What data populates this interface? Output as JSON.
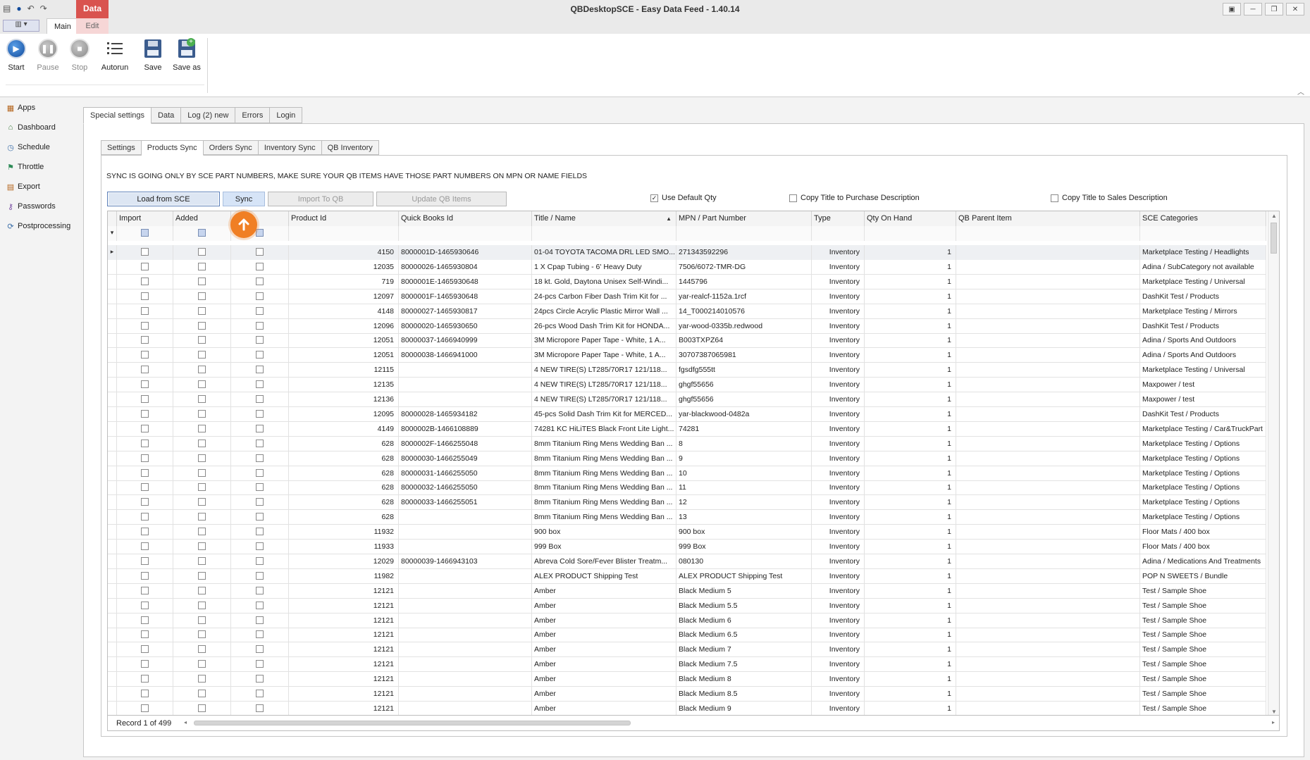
{
  "window": {
    "title": "QBDesktopSCE - Easy Data Feed - 1.40.14",
    "context_tab": "Data",
    "controls": [
      "restore",
      "minimize",
      "maximize",
      "close"
    ]
  },
  "ribbon_tabs": {
    "main": "Main",
    "edit": "Edit"
  },
  "ribbon": {
    "start": "Start",
    "pause": "Pause",
    "stop": "Stop",
    "autorun": "Autorun",
    "save": "Save",
    "save_as": "Save as"
  },
  "nav": [
    {
      "label": "Apps",
      "icon": "apps-icon"
    },
    {
      "label": "Dashboard",
      "icon": "dashboard-icon"
    },
    {
      "label": "Schedule",
      "icon": "schedule-icon"
    },
    {
      "label": "Throttle",
      "icon": "flag-icon"
    },
    {
      "label": "Export",
      "icon": "export-icon"
    },
    {
      "label": "Passwords",
      "icon": "passwords-icon"
    },
    {
      "label": "Postprocessing",
      "icon": "postprocessing-icon"
    }
  ],
  "outer_tabs": [
    "Special settings",
    "Data",
    "Log (2) new",
    "Errors",
    "Login"
  ],
  "inner_tabs": [
    "Settings",
    "Products Sync",
    "Orders Sync",
    "Inventory Sync",
    "QB Inventory"
  ],
  "notice": "SYNC IS GOING ONLY BY SCE PART NUMBERS, MAKE SURE YOUR QB ITEMS HAVE THOSE PART NUMBERS ON MPN OR NAME FIELDS",
  "buttons": {
    "load": "Load from SCE",
    "sync": "Sync",
    "import": "Import To QB",
    "update": "Update QB Items"
  },
  "options": {
    "use_default_qty": {
      "label": "Use Default Qty",
      "checked": true
    },
    "copy_purchase": {
      "label": "Copy Title to Purchase Description",
      "checked": false
    },
    "copy_sales": {
      "label": "Copy Title to Sales Description",
      "checked": false
    }
  },
  "columns": [
    "Import",
    "Added",
    "",
    "Product Id",
    "Quick Books Id",
    "Title / Name",
    "MPN / Part Number",
    "Type",
    "Qty On Hand",
    "QB Parent Item",
    "SCE Categories"
  ],
  "rows": [
    {
      "id": "4150",
      "qb": "8000001D-1465930646",
      "title": "01-04 TOYOTA TACOMA DRL LED SMO...",
      "mpn": "271343592296",
      "type": "Inventory",
      "qty": "1",
      "parent": "",
      "cat": "Marketplace Testing / Headlights"
    },
    {
      "id": "12035",
      "qb": "80000026-1465930804",
      "title": "1 X Cpap Tubing - 6' Heavy Duty",
      "mpn": "7506/6072-TMR-DG",
      "type": "Inventory",
      "qty": "1",
      "parent": "",
      "cat": "Adina / SubCategory not available"
    },
    {
      "id": "719",
      "qb": "8000001E-1465930648",
      "title": "18 kt. Gold, Daytona Unisex Self-Windi...",
      "mpn": "1445796",
      "type": "Inventory",
      "qty": "1",
      "parent": "",
      "cat": "Marketplace Testing / Universal"
    },
    {
      "id": "12097",
      "qb": "8000001F-1465930648",
      "title": "24-pcs Carbon Fiber Dash Trim Kit for ...",
      "mpn": "yar-realcf-1152a.1rcf",
      "type": "Inventory",
      "qty": "1",
      "parent": "",
      "cat": "DashKit Test / Products"
    },
    {
      "id": "4148",
      "qb": "80000027-1465930817",
      "title": "24pcs Circle Acrylic Plastic Mirror Wall ...",
      "mpn": "14_T000214010576",
      "type": "Inventory",
      "qty": "1",
      "parent": "",
      "cat": "Marketplace Testing / Mirrors"
    },
    {
      "id": "12096",
      "qb": "80000020-1465930650",
      "title": "26-pcs Wood Dash Trim Kit for HONDA...",
      "mpn": "yar-wood-0335b.redwood",
      "type": "Inventory",
      "qty": "1",
      "parent": "",
      "cat": "DashKit Test / Products"
    },
    {
      "id": "12051",
      "qb": "80000037-1466940999",
      "title": "3M Micropore Paper Tape - White, 1 A...",
      "mpn": "B003TXPZ64",
      "type": "Inventory",
      "qty": "1",
      "parent": "",
      "cat": "Adina / Sports And Outdoors"
    },
    {
      "id": "12051",
      "qb": "80000038-1466941000",
      "title": "3M Micropore Paper Tape - White, 1 A...",
      "mpn": "30707387065981",
      "type": "Inventory",
      "qty": "1",
      "parent": "",
      "cat": "Adina / Sports And Outdoors"
    },
    {
      "id": "12115",
      "qb": "",
      "title": "4 NEW TIRE(S) LT285/70R17 121/118...",
      "mpn": "fgsdfg555tt",
      "type": "Inventory",
      "qty": "1",
      "parent": "",
      "cat": "Marketplace Testing / Universal"
    },
    {
      "id": "12135",
      "qb": "",
      "title": "4 NEW TIRE(S) LT285/70R17 121/118...",
      "mpn": "ghgf55656",
      "type": "Inventory",
      "qty": "1",
      "parent": "",
      "cat": "Maxpower / test"
    },
    {
      "id": "12136",
      "qb": "",
      "title": "4 NEW TIRE(S) LT285/70R17 121/118...",
      "mpn": "ghgf55656",
      "type": "Inventory",
      "qty": "1",
      "parent": "",
      "cat": "Maxpower / test"
    },
    {
      "id": "12095",
      "qb": "80000028-1465934182",
      "title": "45-pcs Solid Dash Trim Kit for MERCED...",
      "mpn": "yar-blackwood-0482a",
      "type": "Inventory",
      "qty": "1",
      "parent": "",
      "cat": "DashKit Test / Products"
    },
    {
      "id": "4149",
      "qb": "8000002B-1466108889",
      "title": "74281 KC HiLiTES Black Front Lite Light...",
      "mpn": "74281",
      "type": "Inventory",
      "qty": "1",
      "parent": "",
      "cat": "Marketplace Testing / Car&TruckPart"
    },
    {
      "id": "628",
      "qb": "8000002F-1466255048",
      "title": "8mm Titanium Ring Mens Wedding Ban ...",
      "mpn": "8",
      "type": "Inventory",
      "qty": "1",
      "parent": "",
      "cat": "Marketplace Testing / Options"
    },
    {
      "id": "628",
      "qb": "80000030-1466255049",
      "title": "8mm Titanium Ring Mens Wedding Ban ...",
      "mpn": "9",
      "type": "Inventory",
      "qty": "1",
      "parent": "",
      "cat": "Marketplace Testing / Options"
    },
    {
      "id": "628",
      "qb": "80000031-1466255050",
      "title": "8mm Titanium Ring Mens Wedding Ban ...",
      "mpn": "10",
      "type": "Inventory",
      "qty": "1",
      "parent": "",
      "cat": "Marketplace Testing / Options"
    },
    {
      "id": "628",
      "qb": "80000032-1466255050",
      "title": "8mm Titanium Ring Mens Wedding Ban ...",
      "mpn": "11",
      "type": "Inventory",
      "qty": "1",
      "parent": "",
      "cat": "Marketplace Testing / Options"
    },
    {
      "id": "628",
      "qb": "80000033-1466255051",
      "title": "8mm Titanium Ring Mens Wedding Ban ...",
      "mpn": "12",
      "type": "Inventory",
      "qty": "1",
      "parent": "",
      "cat": "Marketplace Testing / Options"
    },
    {
      "id": "628",
      "qb": "",
      "title": "8mm Titanium Ring Mens Wedding Ban ...",
      "mpn": "13",
      "type": "Inventory",
      "qty": "1",
      "parent": "",
      "cat": "Marketplace Testing / Options"
    },
    {
      "id": "11932",
      "qb": "",
      "title": "900 box",
      "mpn": "900 box",
      "type": "Inventory",
      "qty": "1",
      "parent": "",
      "cat": "Floor Mats / 400 box"
    },
    {
      "id": "11933",
      "qb": "",
      "title": "999 Box",
      "mpn": "999 Box",
      "type": "Inventory",
      "qty": "1",
      "parent": "",
      "cat": "Floor Mats / 400 box"
    },
    {
      "id": "12029",
      "qb": "80000039-1466943103",
      "title": "Abreva Cold Sore/Fever Blister Treatm...",
      "mpn": "080130",
      "type": "Inventory",
      "qty": "1",
      "parent": "",
      "cat": "Adina / Medications And Treatments"
    },
    {
      "id": "11982",
      "qb": "",
      "title": "ALEX PRODUCT Shipping Test",
      "mpn": "ALEX PRODUCT Shipping Test",
      "type": "Inventory",
      "qty": "1",
      "parent": "",
      "cat": "POP N SWEETS / Bundle"
    },
    {
      "id": "12121",
      "qb": "",
      "title": "Amber",
      "mpn": "Black Medium 5",
      "type": "Inventory",
      "qty": "1",
      "parent": "",
      "cat": "Test / Sample Shoe"
    },
    {
      "id": "12121",
      "qb": "",
      "title": "Amber",
      "mpn": "Black Medium 5.5",
      "type": "Inventory",
      "qty": "1",
      "parent": "",
      "cat": "Test / Sample Shoe"
    },
    {
      "id": "12121",
      "qb": "",
      "title": "Amber",
      "mpn": "Black Medium 6",
      "type": "Inventory",
      "qty": "1",
      "parent": "",
      "cat": "Test / Sample Shoe"
    },
    {
      "id": "12121",
      "qb": "",
      "title": "Amber",
      "mpn": "Black Medium 6.5",
      "type": "Inventory",
      "qty": "1",
      "parent": "",
      "cat": "Test / Sample Shoe"
    },
    {
      "id": "12121",
      "qb": "",
      "title": "Amber",
      "mpn": "Black Medium 7",
      "type": "Inventory",
      "qty": "1",
      "parent": "",
      "cat": "Test / Sample Shoe"
    },
    {
      "id": "12121",
      "qb": "",
      "title": "Amber",
      "mpn": "Black Medium 7.5",
      "type": "Inventory",
      "qty": "1",
      "parent": "",
      "cat": "Test / Sample Shoe"
    },
    {
      "id": "12121",
      "qb": "",
      "title": "Amber",
      "mpn": "Black Medium 8",
      "type": "Inventory",
      "qty": "1",
      "parent": "",
      "cat": "Test / Sample Shoe"
    },
    {
      "id": "12121",
      "qb": "",
      "title": "Amber",
      "mpn": "Black Medium 8.5",
      "type": "Inventory",
      "qty": "1",
      "parent": "",
      "cat": "Test / Sample Shoe"
    },
    {
      "id": "12121",
      "qb": "",
      "title": "Amber",
      "mpn": "Black Medium 9",
      "type": "Inventory",
      "qty": "1",
      "parent": "",
      "cat": "Test / Sample Shoe"
    }
  ],
  "footer": {
    "record": "Record 1 of 499"
  },
  "colors": {
    "accent_orange": "#f07f24",
    "data_tab_red": "#d9534f",
    "play_blue": "#114a9c"
  }
}
